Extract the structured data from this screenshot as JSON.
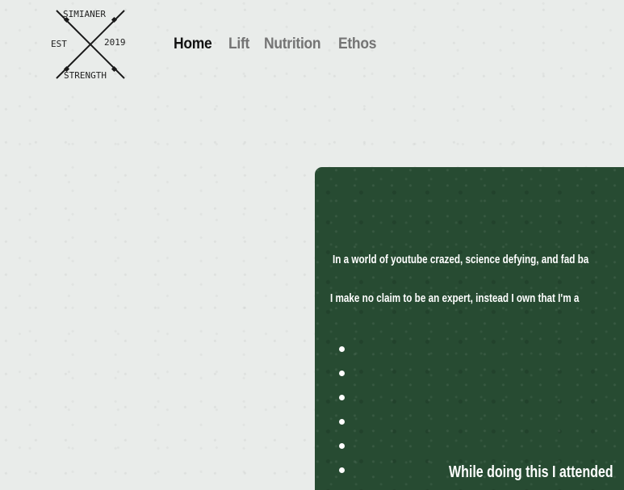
{
  "logo": {
    "top": "SIMIANER",
    "bottom": "STRENGTH",
    "left": "EST",
    "right": "2019"
  },
  "nav": {
    "items": [
      {
        "label": "Home",
        "active": true
      },
      {
        "label": "Lift",
        "active": false
      },
      {
        "label": "Nutrition",
        "active": false
      },
      {
        "label": "Ethos",
        "active": false
      }
    ]
  },
  "panel": {
    "line1": "In a world of youtube crazed, science defying, and fad ba",
    "line2": "I make no claim to be an expert, instead I own that I'm a",
    "bullet_count": 6,
    "heading": "While doing this I attended"
  },
  "colors": {
    "background": "#e9ecea",
    "panel": "#274b32",
    "nav_active": "#111111",
    "nav_inactive": "#747474"
  }
}
